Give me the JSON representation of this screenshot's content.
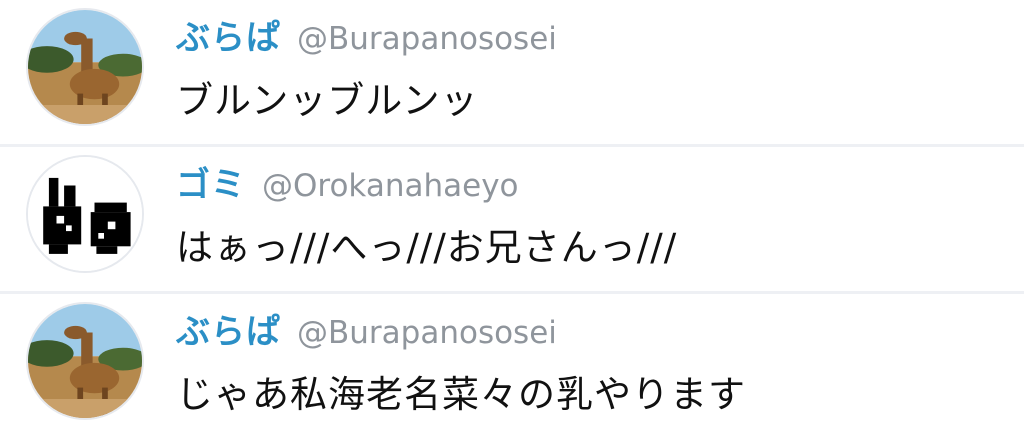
{
  "timeline": {
    "tweets": [
      {
        "display_name": "ぶらぱ",
        "handle": "@Burapanososei",
        "text": "ブルンッブルンッ",
        "avatar_icon": "giraffe-avatar-icon"
      },
      {
        "display_name": "ゴミ",
        "handle": "@Orokanahaeyo",
        "text": "はぁっ///へっ///お兄さんっ///",
        "avatar_icon": "pixel-eyes-avatar-icon"
      },
      {
        "display_name": "ぶらぱ",
        "handle": "@Burapanososei",
        "text": "じゃあ私海老名菜々の乳やります",
        "avatar_icon": "giraffe-avatar-icon"
      }
    ]
  },
  "colors": {
    "display_name": "#2b8fc6",
    "handle": "#8f959c",
    "text": "#111111",
    "divider": "#eef0f4"
  }
}
